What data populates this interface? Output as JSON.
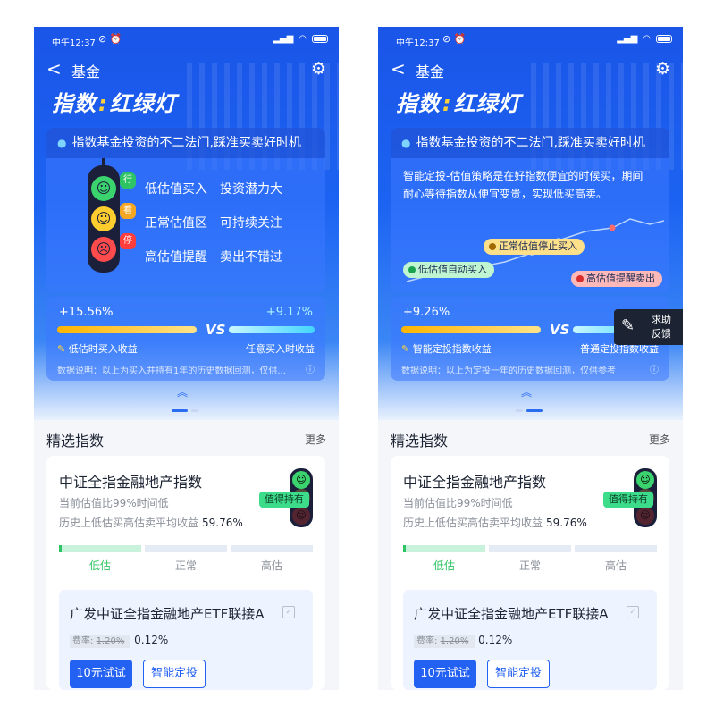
{
  "status_bar": {
    "time": "中午12:37"
  },
  "nav": {
    "back_glyph": "<",
    "title": "基金"
  },
  "brand": {
    "part1": "指数",
    "sep": ":",
    "part2": "红绿灯"
  },
  "info_card": {
    "header": "指数基金投资的不二法门,踩准买卖好时机",
    "traffic_light": {
      "bubbles": [
        "行",
        "看",
        "停"
      ],
      "rows": [
        {
          "a": "低估值买入",
          "b": "投资潜力大"
        },
        {
          "a": "正常估值区",
          "b": "可持续关注"
        },
        {
          "a": "高估值提醒",
          "b": "卖出不错过"
        }
      ]
    },
    "strategy": {
      "desc_line1": "智能定投-估值策略是在好指数便宜的时候买，期间",
      "desc_line2": "耐心等待指数从便宜变贵，实现低买高卖。",
      "pill_low": "低估值自动买入",
      "pill_mid": "正常估值停止买入",
      "pill_high": "高估值提醒卖出"
    }
  },
  "compare": {
    "left": {
      "value": "+15.56%",
      "label": "低估时买入收益",
      "right_value": "+9.17%",
      "right_label": "任意买入时收益",
      "note": "数据说明：以上为买入并持有1年的历史数据回测，仅供..."
    },
    "right": {
      "value": "+9.26%",
      "label": "智能定投指数收益",
      "right_label": "普通定投指数收益",
      "note": "数据说明：以上为定投一年的历史数据回测，仅供参考"
    },
    "vs": "VS",
    "info_glyph": "ⓘ"
  },
  "feedback": {
    "line1": "求助",
    "line2": "反馈"
  },
  "section": {
    "title": "精选指数",
    "more": "更多"
  },
  "index_card": {
    "name": "中证全指金融地产指数",
    "subtitle": "当前估值比99%时间低",
    "history_label": "历史上低估买高估卖平均收益",
    "history_value": "59.76%",
    "badge": "值得持有",
    "scale_labels": [
      "低估",
      "正常",
      "高估"
    ],
    "current_valuation": "低估",
    "fund": {
      "name": "广发中证全指金融地产ETF联接A",
      "fee_label": "费率:",
      "fee_old": "1.20%",
      "fee_new": "0.12%",
      "btn_try": "10元试试",
      "btn_smart": "智能定投"
    }
  },
  "colors": {
    "hero_blue": "#1c63f2",
    "primary_button": "#2361f2",
    "light_green": "#3bd36e",
    "light_yellow": "#ffce2e",
    "light_red": "#ff4b4b",
    "low_accent": "#2fc463"
  }
}
